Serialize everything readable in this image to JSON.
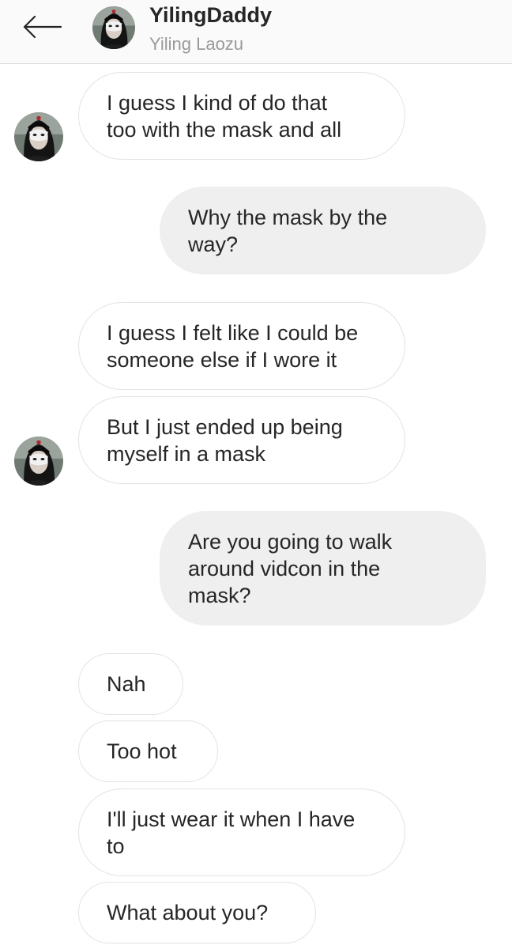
{
  "header": {
    "back_icon": "arrow-left-icon",
    "avatar_icon": "profile-photo-masked-person",
    "title": "YilingDaddy",
    "subtitle": "Yiling Laozu"
  },
  "messages": [
    {
      "side": "received",
      "lines": [
        "I guess I kind of do that",
        "too with the mask and all"
      ]
    },
    {
      "side": "sent",
      "lines": [
        "Why the mask by the",
        "way?"
      ]
    },
    {
      "side": "received",
      "lines": [
        "I guess I felt like I could be",
        "someone else if I wore it"
      ]
    },
    {
      "side": "received",
      "lines": [
        "But I just ended up being",
        "myself in a mask"
      ]
    },
    {
      "side": "sent",
      "lines": [
        "Are you going to walk",
        "around vidcon in the",
        "mask?"
      ]
    },
    {
      "side": "received",
      "lines": [
        "Nah"
      ]
    },
    {
      "side": "received",
      "lines": [
        "Too hot"
      ]
    },
    {
      "side": "received",
      "lines": [
        "I'll just wear it when I have",
        "to"
      ]
    },
    {
      "side": "received",
      "lines": [
        "What about you?"
      ]
    }
  ],
  "colors": {
    "header_bg": "#fafafa",
    "sent_bubble": "#efefef",
    "received_border": "#e3e3e3",
    "text": "#262626",
    "subtitle": "#999999"
  }
}
